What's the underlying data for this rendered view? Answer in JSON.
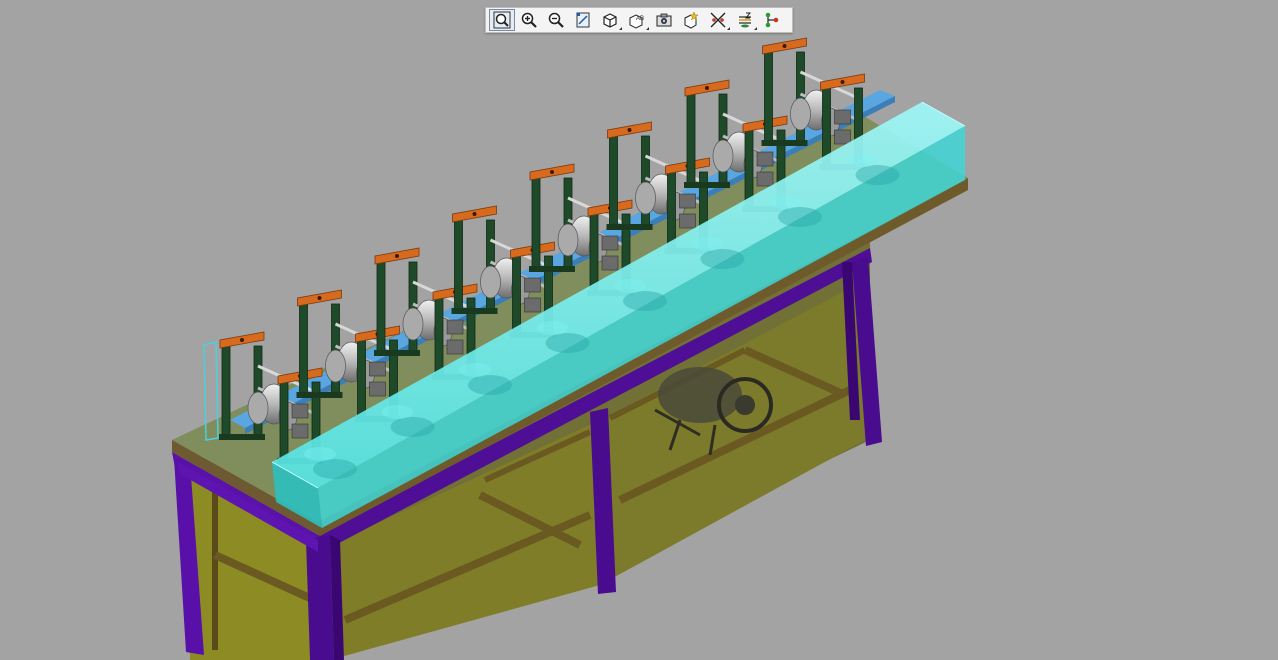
{
  "window": {
    "type": "3d-cad-viewport",
    "background_color": "#a3a3a3"
  },
  "toolbar": {
    "items": [
      {
        "name": "zoom-fit-icon",
        "tooltip": ""
      },
      {
        "name": "zoom-in-icon",
        "tooltip": ""
      },
      {
        "name": "zoom-out-icon",
        "tooltip": ""
      },
      {
        "name": "sketch-view-icon",
        "tooltip": ""
      },
      {
        "name": "view-orientation-icon",
        "tooltip": ""
      },
      {
        "name": "display-style-icon",
        "tooltip": ""
      },
      {
        "name": "camera-icon",
        "tooltip": ""
      },
      {
        "name": "apply-scene-icon",
        "tooltip": ""
      },
      {
        "name": "hide-show-icon",
        "tooltip": ""
      },
      {
        "name": "view-settings-icon",
        "tooltip": ""
      },
      {
        "name": "connections-icon",
        "tooltip": ""
      }
    ]
  },
  "model": {
    "description_visible": false,
    "stand_count": 8,
    "colors": {
      "frame": "#4d0a99",
      "table_top": "#7a8a58",
      "panel": "#8c8a2a",
      "guard": "#3ee8e8",
      "stand": "#1f4a2a",
      "cap": "#d86a1e",
      "roll": "#c8c8c8",
      "rail": "#5aa0d8"
    }
  }
}
